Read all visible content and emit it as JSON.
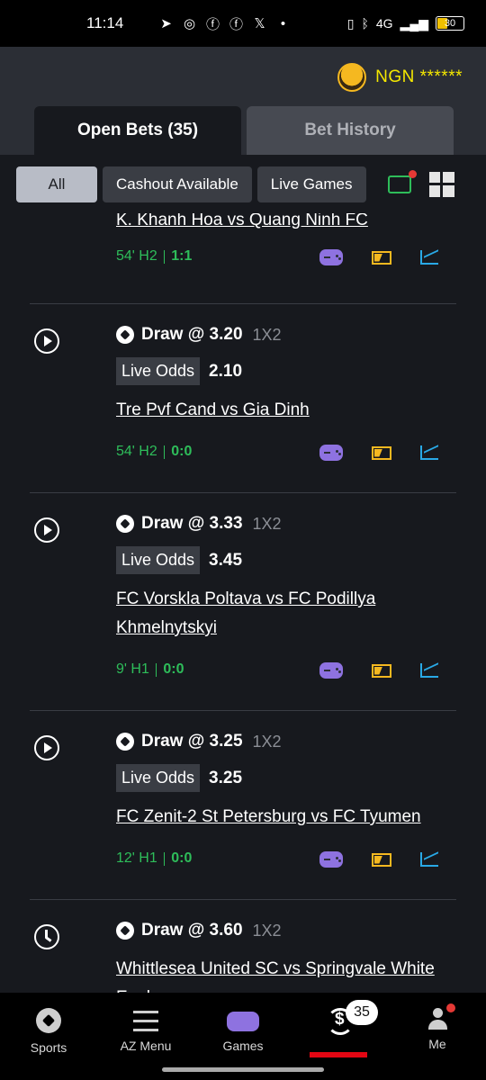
{
  "status_bar": {
    "time": "11:14",
    "network": "4G",
    "battery": "30"
  },
  "header": {
    "currency": "NGN",
    "balance_masked": "******"
  },
  "tabs": {
    "open_bets": "Open Bets (35)",
    "bet_history": "Bet History"
  },
  "filters": {
    "all": "All",
    "cashout": "Cashout Available",
    "live": "Live Games"
  },
  "bets": [
    {
      "match": "K. Khanh Hoa vs Quang Ninh FC",
      "minute": "54' H2",
      "score": "1:1"
    },
    {
      "selection": "Draw @ 3.20",
      "market": "1X2",
      "live_odds_label": "Live Odds",
      "live_odds": "2.10",
      "match": "Tre Pvf Cand vs Gia Dinh",
      "minute": "54' H2",
      "score": "0:0"
    },
    {
      "selection": "Draw @ 3.33",
      "market": "1X2",
      "live_odds_label": "Live Odds",
      "live_odds": "3.45",
      "match": "FC Vorskla Poltava vs FC Podillya Khmelnytskyi",
      "minute": "9' H1",
      "score": "0:0"
    },
    {
      "selection": "Draw @ 3.25",
      "market": "1X2",
      "live_odds_label": "Live Odds",
      "live_odds": "3.25",
      "match": "FC Zenit-2 St Petersburg vs FC Tyumen",
      "minute": "12' H1",
      "score": "0:0"
    },
    {
      "selection": "Draw @ 3.60",
      "market": "1X2",
      "match": "Whittlesea United SC vs Springvale White Eagles"
    }
  ],
  "bottom_nav": {
    "sports": "Sports",
    "az_menu": "AZ Menu",
    "games": "Games",
    "bets_badge": "35",
    "me": "Me"
  }
}
